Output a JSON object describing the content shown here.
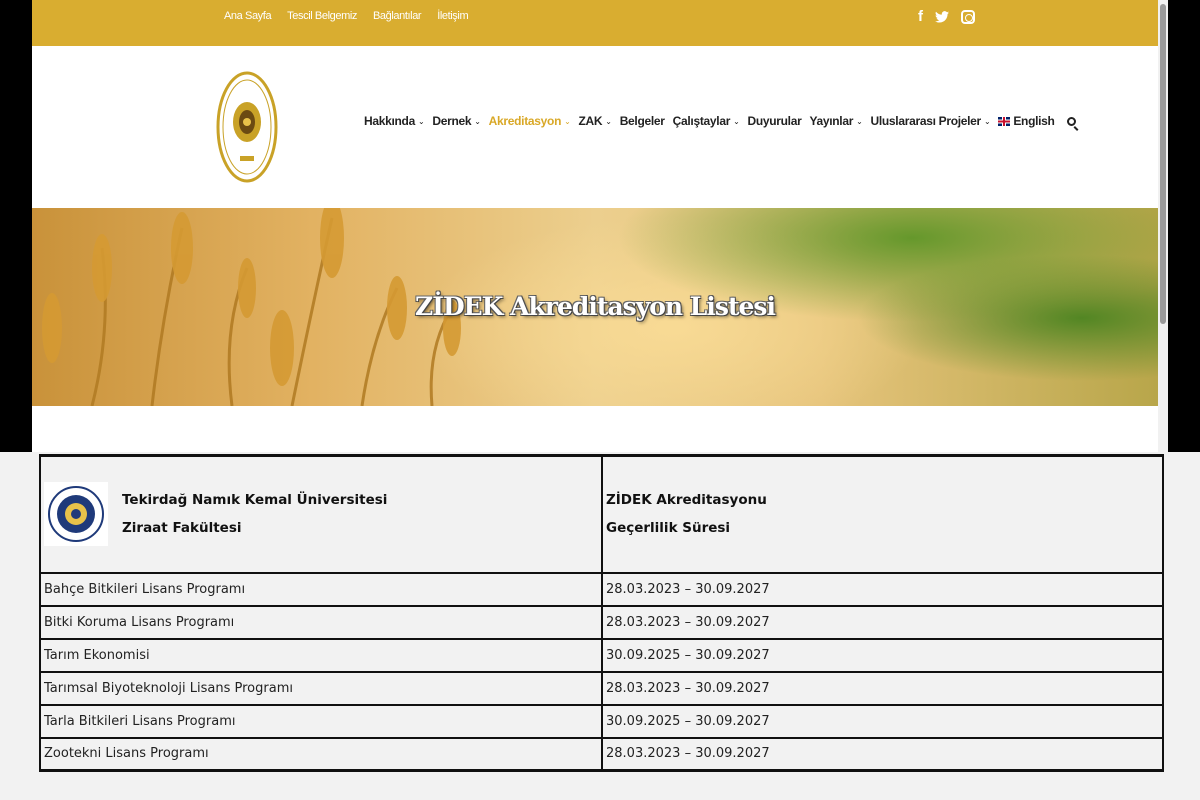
{
  "topbar": {
    "links": [
      "Ana Sayfa",
      "Tescil Belgemiz",
      "Bağlantılar",
      "İletişim"
    ],
    "social_icons": [
      "facebook-icon",
      "twitter-icon",
      "instagram-icon"
    ],
    "color": "#d9ad30"
  },
  "nav": {
    "items": [
      {
        "label": "Hakkında",
        "dropdown": true
      },
      {
        "label": "Dernek",
        "dropdown": true
      },
      {
        "label": "Akreditasyon",
        "dropdown": true,
        "active": true
      },
      {
        "label": "ZAK",
        "dropdown": true
      },
      {
        "label": "Belgeler",
        "dropdown": false
      },
      {
        "label": "Çalıştaylar",
        "dropdown": true
      },
      {
        "label": "Duyurular",
        "dropdown": false
      },
      {
        "label": "Yayınlar",
        "dropdown": true
      },
      {
        "label": "Uluslararası Projeler",
        "dropdown": true
      }
    ],
    "language": "English",
    "active_color": "#d9a827"
  },
  "hero": {
    "title": "ZİDEK Akreditasyon Listesi"
  },
  "table": {
    "header": {
      "university": "Tekirdağ Namık Kemal Üniversitesi",
      "faculty": "Ziraat Fakültesi",
      "validity_line1": "ZİDEK Akreditasyonu",
      "validity_line2": "Geçerlilik Süresi"
    },
    "rows": [
      {
        "program": "Bahçe Bitkileri Lisans Programı",
        "period": "28.03.2023 – 30.09.2027"
      },
      {
        "program": "Bitki Koruma Lisans Programı",
        "period": "28.03.2023 – 30.09.2027"
      },
      {
        "program": "Tarım Ekonomisi",
        "period": "30.09.2025 – 30.09.2027"
      },
      {
        "program": "Tarımsal Biyoteknoloji Lisans Programı",
        "period": "28.03.2023 – 30.09.2027"
      },
      {
        "program": "Tarla Bitkileri Lisans Programı",
        "period": "30.09.2025 – 30.09.2027"
      },
      {
        "program": "Zootekni Lisans Programı",
        "period": "28.03.2023 – 30.09.2027"
      }
    ]
  }
}
